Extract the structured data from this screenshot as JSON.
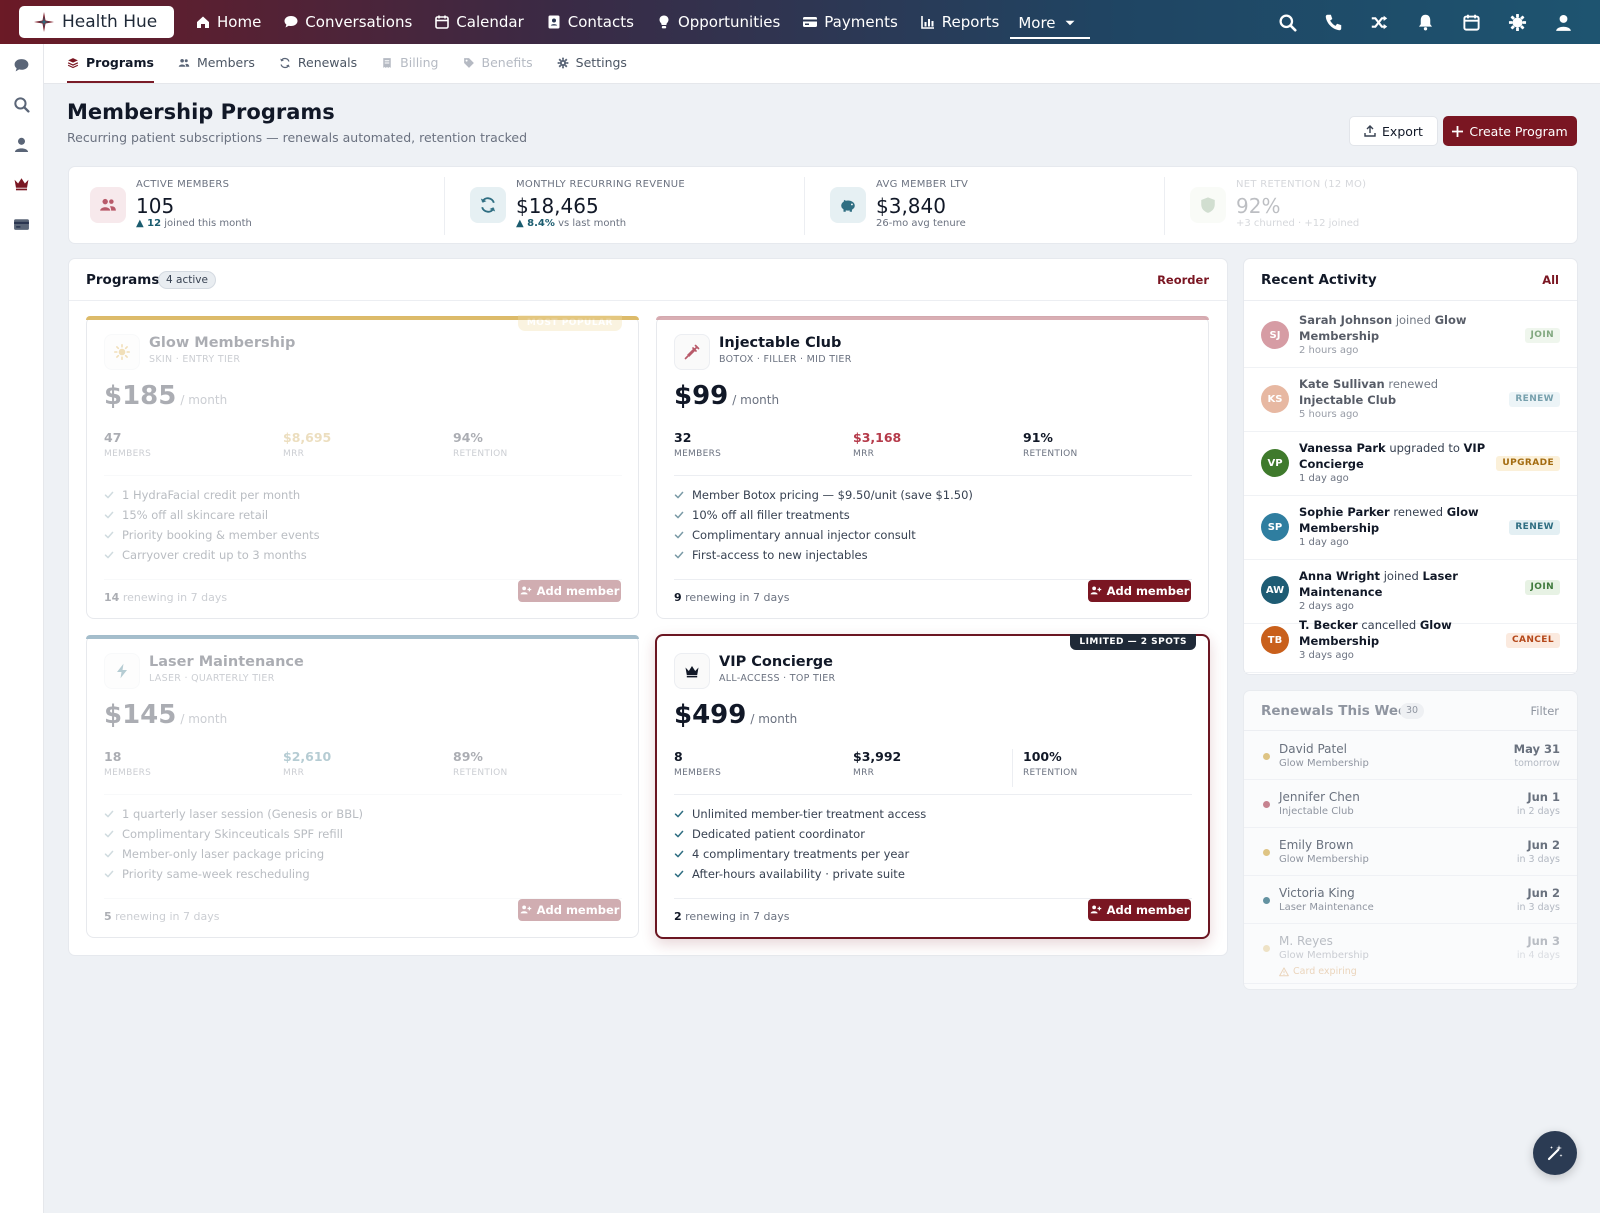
{
  "app": {
    "name": "Health Hue"
  },
  "topnav": {
    "items": [
      {
        "label": "Home",
        "icon": "home-icon"
      },
      {
        "label": "Conversations",
        "icon": "chat-icon"
      },
      {
        "label": "Calendar",
        "icon": "calendar-icon"
      },
      {
        "label": "Contacts",
        "icon": "contact-card-icon"
      },
      {
        "label": "Opportunities",
        "icon": "lightbulb-icon"
      },
      {
        "label": "Payments",
        "icon": "credit-card-icon"
      },
      {
        "label": "Reports",
        "icon": "bar-chart-icon"
      }
    ],
    "more_label": "More",
    "right_icons": [
      "search-icon",
      "phone-icon",
      "shuffle-icon",
      "bell-icon",
      "calendar-icon",
      "gear-icon",
      "user-icon"
    ]
  },
  "rail": {
    "icons": [
      "chat-icon",
      "search-icon",
      "user-icon",
      "crown-icon",
      "credit-card-icon"
    ]
  },
  "subtabs": [
    {
      "label": "Programs",
      "icon": "layers-icon",
      "state": "active"
    },
    {
      "label": "Members",
      "icon": "users-icon",
      "state": "normal"
    },
    {
      "label": "Renewals",
      "icon": "refresh-icon",
      "state": "normal"
    },
    {
      "label": "Billing",
      "icon": "receipt-icon",
      "state": "disabled"
    },
    {
      "label": "Benefits",
      "icon": "tag-icon",
      "state": "disabled"
    },
    {
      "label": "Settings",
      "icon": "gear-icon",
      "state": "normal"
    }
  ],
  "header": {
    "title": "Membership Programs",
    "subtitle": "Recurring patient subscriptions — renewals automated, retention tracked",
    "export_label": "Export",
    "create_label": "Create Program"
  },
  "stats": [
    {
      "label": "ACTIVE MEMBERS",
      "value": "105",
      "delta": "▲ 12",
      "note": "joined this month",
      "icon": "users-icon",
      "color": "#b85a6a",
      "bg": "#f7e9ec"
    },
    {
      "label": "MONTHLY RECURRING REVENUE",
      "value": "$18,465",
      "delta": "▲ 8.4%",
      "note": "vs last month",
      "icon": "refresh-icon",
      "color": "#2f6e82",
      "bg": "#e6f0f3"
    },
    {
      "label": "AVG MEMBER LTV",
      "value": "$3,840",
      "delta": "",
      "note": "26-mo avg tenure",
      "icon": "piggy-bank-icon",
      "color": "#2f6e82",
      "bg": "#e6f0f3"
    },
    {
      "label": "NET RETENTION (12 MO)",
      "value": "92%",
      "delta": "",
      "note": "+3 churned · +12 joined",
      "icon": "shield-icon",
      "color": "#5c8a5a",
      "bg": "#eaf1e6"
    }
  ],
  "programs_panel": {
    "title": "Programs",
    "pill": "4 active",
    "action": "Reorder"
  },
  "programs": [
    {
      "name": "Glow Membership",
      "tier": "SKIN · ENTRY TIER",
      "price": "$185",
      "per": "/ month",
      "members": "47",
      "mrr": "$8,695",
      "retention": "94%",
      "members_label": "MEMBERS",
      "mrr_label": "MRR",
      "retention_label": "RETENTION",
      "features": [
        "1 HydraFacial credit per month",
        "15% off all skincare retail",
        "Priority booking & member events",
        "Carryover credit up to 3 months"
      ],
      "renew_count": "14",
      "renew_text": "renewing in 7 days",
      "button": "Add member",
      "badge": "MOST POPULAR",
      "accent": "#d9b45a",
      "icon": "sparkle-icon",
      "icon_color": "#d9a53a",
      "mrr_color": "#c9a24a"
    },
    {
      "name": "Injectable Club",
      "tier": "BOTOX · FILLER · MID TIER",
      "price": "$99",
      "per": "/ month",
      "members": "32",
      "mrr": "$3,168",
      "retention": "91%",
      "members_label": "MEMBERS",
      "mrr_label": "MRR",
      "retention_label": "RETENTION",
      "features": [
        "Member Botox pricing — $9.50/unit (save $1.50)",
        "10% off all filler treatments",
        "Complimentary annual injector consult",
        "First-access to new injectables"
      ],
      "renew_count": "9",
      "renew_text": "renewing in 7 days",
      "button": "Add member",
      "badge": "",
      "accent": "#c98c93",
      "icon": "syringe-icon",
      "icon_color": "#b85a6a",
      "mrr_color": "#b53a4a"
    },
    {
      "name": "Laser Maintenance",
      "tier": "LASER · QUARTERLY TIER",
      "price": "$145",
      "per": "/ month",
      "members": "18",
      "mrr": "$2,610",
      "retention": "89%",
      "members_label": "MEMBERS",
      "mrr_label": "MRR",
      "retention_label": "RETENTION",
      "features": [
        "1 quarterly laser session (Genesis or BBL)",
        "Complimentary Skinceuticals SPF refill",
        "Member-only laser package pricing",
        "Priority same-week rescheduling"
      ],
      "renew_count": "5",
      "renew_text": "renewing in 7 days",
      "button": "Add member",
      "badge": "",
      "accent": "#9bb7c6",
      "icon": "lightning-icon",
      "icon_color": "#2f6e82",
      "mrr_color": "#2f6e82"
    },
    {
      "name": "VIP Concierge",
      "tier": "ALL-ACCESS · TOP TIER",
      "price": "$499",
      "per": "/ month",
      "members": "8",
      "mrr": "$3,992",
      "retention": "100%",
      "members_label": "MEMBERS",
      "mrr_label": "MRR",
      "retention_label": "RETENTION",
      "features": [
        "Unlimited member-tier treatment access",
        "Dedicated patient coordinator",
        "4 complimentary treatments per year",
        "After-hours availability · private suite"
      ],
      "renew_count": "2",
      "renew_text": "renewing in 7 days",
      "button": "Add member",
      "badge": "LIMITED — 2 SPOTS",
      "accent": "#6b1622",
      "icon": "crown-icon",
      "icon_color": "#111827",
      "mrr_color": "#111827"
    }
  ],
  "activity": {
    "title": "Recent Activity",
    "action": "All",
    "items": [
      {
        "initials": "SJ",
        "color": "#c97b86",
        "name": "Sarah Johnson",
        "verb": "joined",
        "target": "Glow Membership",
        "time": "2 hours ago",
        "tag": "JOIN",
        "tag_color": "#3f7a3c",
        "tag_bg": "#e7f2e4"
      },
      {
        "initials": "KS",
        "color": "#e0a184",
        "name": "Kate Sullivan",
        "verb": "renewed",
        "target": "Injectable Club",
        "time": "5 hours ago",
        "tag": "RENEW",
        "tag_color": "#2f6e82",
        "tag_bg": "#e3eff3"
      },
      {
        "initials": "VP",
        "color": "#3f7a2c",
        "name": "Vanessa Park",
        "verb": "upgraded to",
        "target": "VIP Concierge",
        "time": "1 day ago",
        "tag": "UPGRADE",
        "tag_color": "#a36b10",
        "tag_bg": "#fbf0d9"
      },
      {
        "initials": "SP",
        "color": "#2f7ea0",
        "name": "Sophie Parker",
        "verb": "renewed",
        "target": "Glow Membership",
        "time": "1 day ago",
        "tag": "RENEW",
        "tag_color": "#2f6e82",
        "tag_bg": "#e3eff3"
      },
      {
        "initials": "AW",
        "color": "#1e5c74",
        "name": "Anna Wright",
        "verb": "joined",
        "target": "Laser Maintenance",
        "time": "2 days ago",
        "tag": "JOIN",
        "tag_color": "#3f7a3c",
        "tag_bg": "#e7f2e4"
      },
      {
        "initials": "TB",
        "color": "#c9601c",
        "name": "T. Becker",
        "verb": "cancelled",
        "target": "Glow Membership",
        "time": "3 days ago",
        "tag": "CANCEL",
        "tag_color": "#b5481a",
        "tag_bg": "#fbeadf"
      }
    ]
  },
  "renewals": {
    "title": "Renewals This Week",
    "count": "30",
    "action": "Filter",
    "items": [
      {
        "name": "David Patel",
        "program": "Glow Membership",
        "date": "May 31",
        "relative": "tomorrow",
        "dot": "#d9b45a"
      },
      {
        "name": "Jennifer Chen",
        "program": "Injectable Club",
        "date": "Jun 1",
        "relative": "in 2 days",
        "dot": "#b85a6a"
      },
      {
        "name": "Emily Brown",
        "program": "Glow Membership",
        "date": "Jun 2",
        "relative": "in 3 days",
        "dot": "#d9b45a"
      },
      {
        "name": "Victoria King",
        "program": "Laser Maintenance",
        "date": "Jun 2",
        "relative": "in 3 days",
        "dot": "#2f6e82"
      },
      {
        "name": "M. Reyes",
        "program": "Glow Membership",
        "date": "Jun 3",
        "relative": "in 4 days",
        "dot": "#d9b45a",
        "warning": "Card expiring"
      }
    ]
  },
  "fab": {
    "icon": "magic-wand-icon"
  }
}
